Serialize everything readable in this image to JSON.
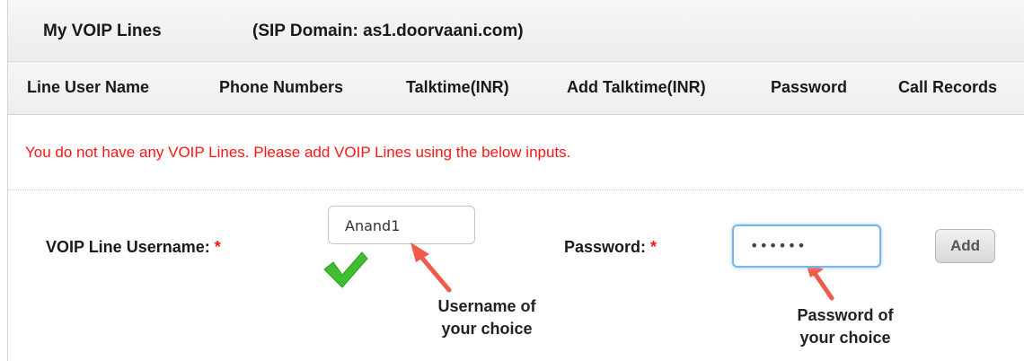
{
  "title_bar": {
    "title": "My VOIP Lines",
    "sip_domain": "(SIP Domain: as1.doorvaani.com)"
  },
  "columns": [
    "Line User Name",
    "Phone Numbers",
    "Talktime(INR)",
    "Add Talktime(INR)",
    "Password",
    "Call Records"
  ],
  "message": "You do not have any VOIP Lines. Please add VOIP Lines using the below inputs.",
  "form": {
    "username_label": "VOIP Line Username:",
    "username_value": "Anand1",
    "password_label": "Password:",
    "password_value": "••••••",
    "required_marker": "*",
    "add_label": "Add"
  },
  "annotations": {
    "username_note_line1": "Username of",
    "username_note_line2": "your choice",
    "password_note_line1": "Password of",
    "password_note_line2": "your choice"
  },
  "colors": {
    "error_text": "#ff1414",
    "arrow": "#f05a4a",
    "checkmark": "#3fbf2f",
    "focus_border": "#7bb4e8"
  },
  "icons": {
    "validation": "checkmark-icon",
    "annotation": "arrow-icon"
  }
}
